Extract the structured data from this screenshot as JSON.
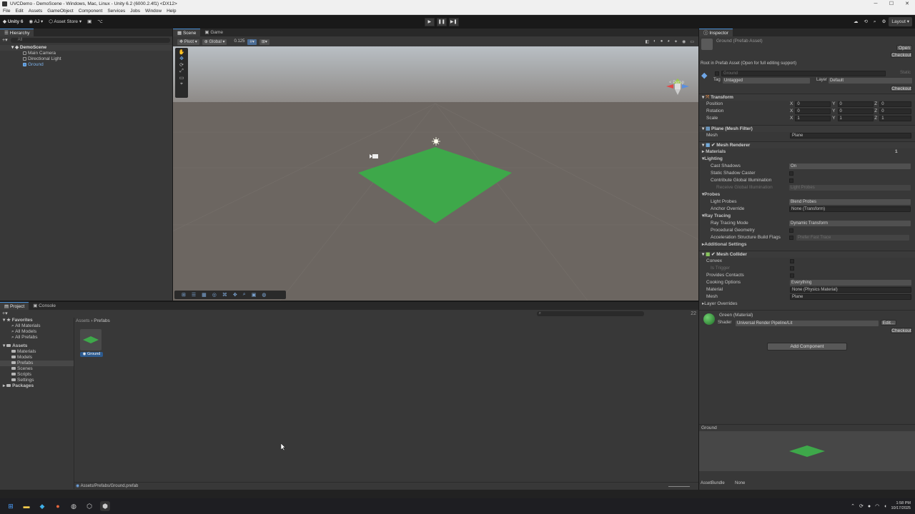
{
  "window": {
    "title": "UVCDemo - DemoScene - Windows, Mac, Linux - Unity 6.2 (6000.2.4f1) <DX12>",
    "controls": [
      "─",
      "☐",
      "✕"
    ]
  },
  "menu": [
    "File",
    "Edit",
    "Assets",
    "GameObject",
    "Component",
    "Services",
    "Jobs",
    "Window",
    "Help"
  ],
  "toolbar": {
    "account": "Unity 6",
    "user": "AJ",
    "asset_store": "Asset Store",
    "layout": "Layout"
  },
  "hierarchy": {
    "tab": "Hierarchy",
    "search_placeholder": "All",
    "scene": "DemoScene",
    "items": [
      "Main Camera",
      "Directional Light",
      "Ground"
    ]
  },
  "scene_view": {
    "tabs": [
      "Scene",
      "Game"
    ],
    "pivot": "Pivot",
    "global": "Global",
    "grid_value": "0.125",
    "persp": "< Persp",
    "ground_color": "#3ea84a"
  },
  "project": {
    "tabs": [
      "Project",
      "Console"
    ],
    "favorites": "Favorites",
    "fav_items": [
      "All Materials",
      "All Models",
      "All Prefabs"
    ],
    "assets": "Assets",
    "asset_folders": [
      "Materials",
      "Models",
      "Prefabs",
      "Scenes",
      "Scripts",
      "Settings"
    ],
    "packages": "Packages",
    "breadcrumb": [
      "Assets",
      "Prefabs"
    ],
    "item": "Ground",
    "footer_path": "Assets/Prefabs/Ground.prefab",
    "count": "22"
  },
  "inspector": {
    "tab": "Inspector",
    "asset_title": "Ground (Prefab Asset)",
    "open": "Open",
    "checkout": "Checkout",
    "root_note": "Root in Prefab Asset (Open for full editing support)",
    "name": "Ground",
    "static": "Static",
    "tag_label": "Tag",
    "tag": "Untagged",
    "layer_label": "Layer",
    "layer": "Default",
    "transform": {
      "title": "Transform",
      "position": "Position",
      "rotation": "Rotation",
      "scale": "Scale",
      "pos": [
        "0",
        "0",
        "0"
      ],
      "rot": [
        "0",
        "0",
        "0"
      ],
      "scl": [
        "1",
        "1",
        "1"
      ]
    },
    "mesh_filter": {
      "title": "Plane (Mesh Filter)",
      "mesh_label": "Mesh",
      "mesh": "Plane"
    },
    "mesh_renderer": {
      "title": "Mesh Renderer",
      "materials": "Materials",
      "materials_count": "1",
      "lighting": "Lighting",
      "rows": [
        [
          "Cast Shadows",
          "On"
        ],
        [
          "Static Shadow Caster",
          ""
        ],
        [
          "Contribute Global Illumination",
          ""
        ],
        [
          "Receive Global Illumination",
          "Light Probes"
        ]
      ],
      "probes": "Probes",
      "probe_rows": [
        [
          "Light Probes",
          "Blend Probes"
        ],
        [
          "Anchor Override",
          "None (Transform)"
        ]
      ],
      "ray_tracing": "Ray Tracing",
      "rt_rows": [
        [
          "Ray Tracing Mode",
          "Dynamic Transform"
        ],
        [
          "Procedural Geometry",
          ""
        ],
        [
          "Acceleration Structure Build Flags",
          "Prefer Fast Trace"
        ]
      ],
      "additional": "Additional Settings"
    },
    "mesh_collider": {
      "title": "Mesh Collider",
      "rows": [
        [
          "Convex",
          ""
        ],
        [
          "Is Trigger",
          ""
        ],
        [
          "Provides Contacts",
          ""
        ],
        [
          "Cooking Options",
          "Everything"
        ],
        [
          "Material",
          "None (Physics Material)"
        ],
        [
          "Mesh",
          "Plane"
        ]
      ],
      "layer_overrides": "Layer Overrides"
    },
    "material": {
      "title": "Green (Material)",
      "shader_label": "Shader",
      "shader": "Universal Render Pipeline/Lit",
      "edit": "Edit...",
      "checkout": "Checkout"
    },
    "add_component": "Add Component",
    "preview_title": "Ground",
    "assetbundle_label": "AssetBundle",
    "assetbundle": "None"
  },
  "taskbar": {
    "time": "1:58 PM",
    "date": "10/17/2025"
  }
}
